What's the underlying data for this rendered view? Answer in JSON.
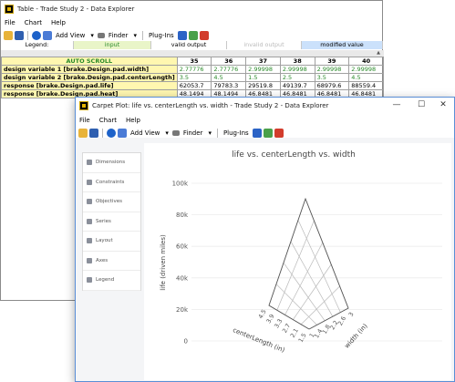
{
  "table_window": {
    "title": "Table - Trade Study 2 - Data Explorer",
    "menu": [
      "File",
      "Chart",
      "Help"
    ],
    "toolbar": {
      "add_view": "Add View",
      "finder": "Finder",
      "plugins": "Plug-Ins"
    },
    "legend": {
      "label": "Legend:",
      "input": "input",
      "valid": "valid output",
      "invalid": "invalid output",
      "modified": "modified value"
    },
    "auto_scroll": "AUTO SCROLL",
    "columns": [
      "35",
      "36",
      "37",
      "38",
      "39",
      "40"
    ],
    "rows": [
      {
        "label": "design variable 1 [brake.Design.pad.width]",
        "values": [
          "2.77776",
          "2.77776",
          "2.99998",
          "2.99998",
          "2.99998",
          "2.99998"
        ],
        "kind": "input"
      },
      {
        "label": "design variable 2 [brake.Design.pad.centerLength]",
        "values": [
          "3.5",
          "4.5",
          "1.5",
          "2.5",
          "3.5",
          "4.5"
        ],
        "kind": "input"
      },
      {
        "label": "response [brake.Design.pad.life]",
        "values": [
          "62053.7",
          "79783.3",
          "29519.8",
          "49139.7",
          "68979.6",
          "88559.4"
        ],
        "kind": "output"
      },
      {
        "label": "response [brake.Design.pad.heat]",
        "values": [
          "48.1494",
          "48.1494",
          "46.8481",
          "46.8481",
          "46.8481",
          "46.8481"
        ],
        "kind": "output"
      }
    ]
  },
  "chart_window": {
    "title": "Carpet Plot: life vs. centerLength vs. width - Trade Study 2 - Data Explorer",
    "menu": [
      "File",
      "Chart",
      "Help"
    ],
    "toolbar": {
      "add_view": "Add View",
      "finder": "Finder",
      "plugins": "Plug-Ins"
    },
    "controls": {
      "minimize": "—",
      "maximize": "☐",
      "close": "✕"
    },
    "panel_items": [
      "Dimensions",
      "Constraints",
      "Objectives",
      "Series",
      "Layout",
      "Axes",
      "Legend"
    ]
  },
  "chart_data": {
    "type": "carpet",
    "title": "life vs. centerLength vs. width",
    "ylabel": "life (driven miles)",
    "y_ticks": [
      "0",
      "20k",
      "40k",
      "60k",
      "80k",
      "100k"
    ],
    "ylim": [
      0,
      100000
    ],
    "x_axis_left": {
      "label": "centerLength (in)",
      "ticks": [
        "4.5",
        "3.9",
        "3.3",
        "2.7",
        "2.1",
        "1.5"
      ]
    },
    "x_axis_right": {
      "label": "width (in)",
      "ticks": [
        "1",
        "1.4",
        "1.8",
        "2.2",
        "2.6",
        "3"
      ]
    },
    "grid": true
  }
}
